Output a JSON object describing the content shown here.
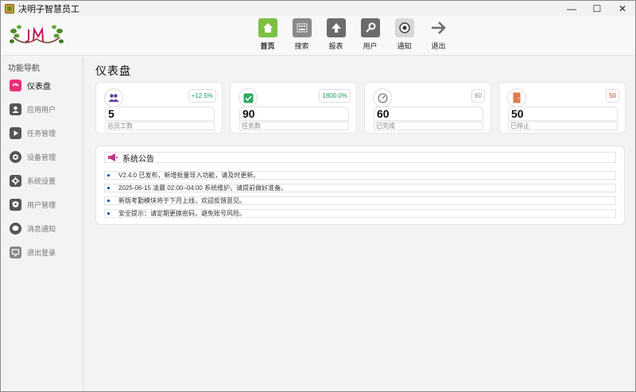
{
  "window": {
    "title": "决明子智慧员工",
    "controls": [
      "—",
      "☐",
      "✕"
    ]
  },
  "toolbar": {
    "items": [
      {
        "label": "首页",
        "icon": "home-icon",
        "color": "#7bc043",
        "active": true
      },
      {
        "label": "搜索",
        "icon": "keyboard-icon",
        "color": "#8a8a8a",
        "active": false
      },
      {
        "label": "报表",
        "icon": "upload-icon",
        "color": "#6b6b6b",
        "active": false
      },
      {
        "label": "用户",
        "icon": "key-icon",
        "color": "#6b6b6b",
        "active": false
      },
      {
        "label": "通知",
        "icon": "clock-icon",
        "color": "#8a8a8a",
        "active": false
      },
      {
        "label": "退出",
        "icon": "arrow-right-icon",
        "color": "#6b6b6b",
        "active": false
      }
    ]
  },
  "sidebar": {
    "title": "功能导航",
    "items": [
      {
        "label": "仪表盘",
        "icon": "dashboard-icon",
        "color": "#e8317a",
        "active": true
      },
      {
        "label": "应用用户",
        "icon": "user-icon",
        "color": "#555555",
        "active": false
      },
      {
        "label": "任务管理",
        "icon": "play-icon",
        "color": "#555555",
        "active": false
      },
      {
        "label": "设备管理",
        "icon": "device-icon",
        "color": "#555555",
        "active": false
      },
      {
        "label": "系统设置",
        "icon": "gear-icon",
        "color": "#555555",
        "active": false
      },
      {
        "label": "用户管理",
        "icon": "shield-user-icon",
        "color": "#555555",
        "active": false
      },
      {
        "label": "消息通知",
        "icon": "chat-icon",
        "color": "#555555",
        "active": false
      },
      {
        "label": "退出登录",
        "icon": "monitor-icon",
        "color": "#888888",
        "active": false
      }
    ]
  },
  "main": {
    "title": "仪表盘",
    "cards": [
      {
        "value": "5",
        "label": "总员工数",
        "badge": "+12.5%",
        "badge_color": "#1aa05a",
        "icon": "group-icon",
        "icon_color": "#5a3a9a"
      },
      {
        "value": "90",
        "label": "任务数",
        "badge": "1800.0%",
        "badge_color": "#1aa05a",
        "icon": "check-icon",
        "icon_color": "#2eaa62"
      },
      {
        "value": "60",
        "label": "已完成",
        "badge": "60",
        "badge_color": "#888888",
        "icon": "gauge-icon",
        "icon_color": "#666666"
      },
      {
        "value": "50",
        "label": "已停止",
        "badge": "50",
        "badge_color": "#d23a2a",
        "icon": "door-icon",
        "icon_color": "#e07a4a"
      }
    ],
    "notice": {
      "title": "系统公告",
      "icon": "megaphone-icon",
      "items": [
        "V2.4.0 已发布，新增批量导入功能，请及时更新。",
        "2025-06-15 凌晨 02:00–04:00 系统维护，请提前做好准备。",
        "新版考勤模块将于下月上线，欢迎反馈意见。",
        "安全提示：请定期更换密码，避免账号风险。"
      ]
    }
  }
}
